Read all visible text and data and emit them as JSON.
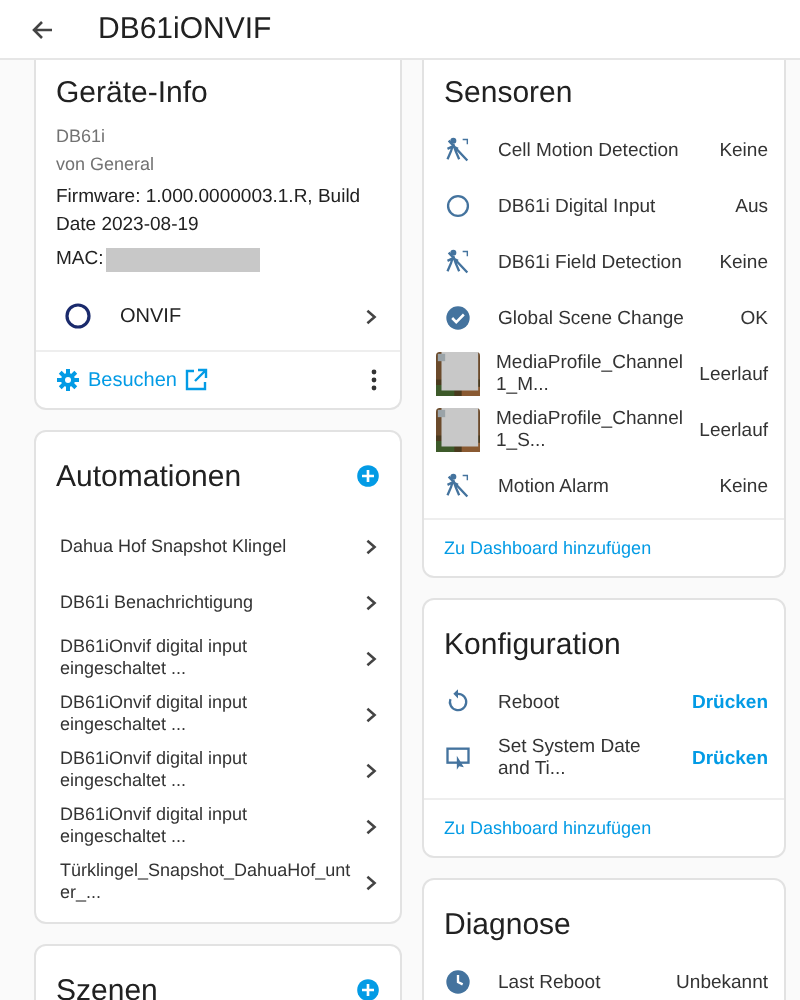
{
  "header": {
    "title": "DB61iONVIF"
  },
  "device_info": {
    "title": "Geräte-Info",
    "model": "DB61i",
    "manufacturer": "von General",
    "firmware": "Firmware: 1.000.0000003.1.R, Build Date 2023-08-19",
    "mac_label": "MAC:",
    "integration": "ONVIF",
    "visit": "Besuchen"
  },
  "automations": {
    "title": "Automationen",
    "items": [
      {
        "label": "Dahua Hof Snapshot Klingel"
      },
      {
        "label": "DB61i Benachrichtigung"
      },
      {
        "label": "DB61iOnvif digital input eingeschaltet ..."
      },
      {
        "label": "DB61iOnvif digital input eingeschaltet ..."
      },
      {
        "label": "DB61iOnvif digital input eingeschaltet ..."
      },
      {
        "label": "DB61iOnvif digital input eingeschaltet ..."
      },
      {
        "label": "Türklingel_Snapshot_DahuaHof_unter_..."
      }
    ]
  },
  "scenes": {
    "title": "Szenen"
  },
  "sensors": {
    "title": "Sensoren",
    "items": [
      {
        "kind": "motion",
        "name": "Cell Motion Detection",
        "state": "Keine"
      },
      {
        "kind": "circle",
        "name": "DB61i Digital Input",
        "state": "Aus"
      },
      {
        "kind": "motion",
        "name": "DB61i Field Detection",
        "state": "Keine"
      },
      {
        "kind": "check",
        "name": "Global Scene Change",
        "state": "OK"
      },
      {
        "kind": "picture",
        "name": "MediaProfile_Channel1_M...",
        "state": "Leerlauf"
      },
      {
        "kind": "picture",
        "name": "MediaProfile_Channel1_S...",
        "state": "Leerlauf"
      },
      {
        "kind": "motion",
        "name": "Motion Alarm",
        "state": "Keine"
      }
    ],
    "add_link": "Zu Dashboard hinzufügen"
  },
  "configuration": {
    "title": "Konfiguration",
    "items": [
      {
        "kind": "restart",
        "name": "Reboot",
        "action": "Drücken"
      },
      {
        "kind": "screen",
        "name": "Set System Date and Ti...",
        "action": "Drücken"
      }
    ],
    "add_link": "Zu Dashboard hinzufügen"
  },
  "diagnostics": {
    "title": "Diagnose",
    "items": [
      {
        "kind": "clock",
        "name": "Last Reboot",
        "state": "Unbekannt"
      }
    ]
  }
}
